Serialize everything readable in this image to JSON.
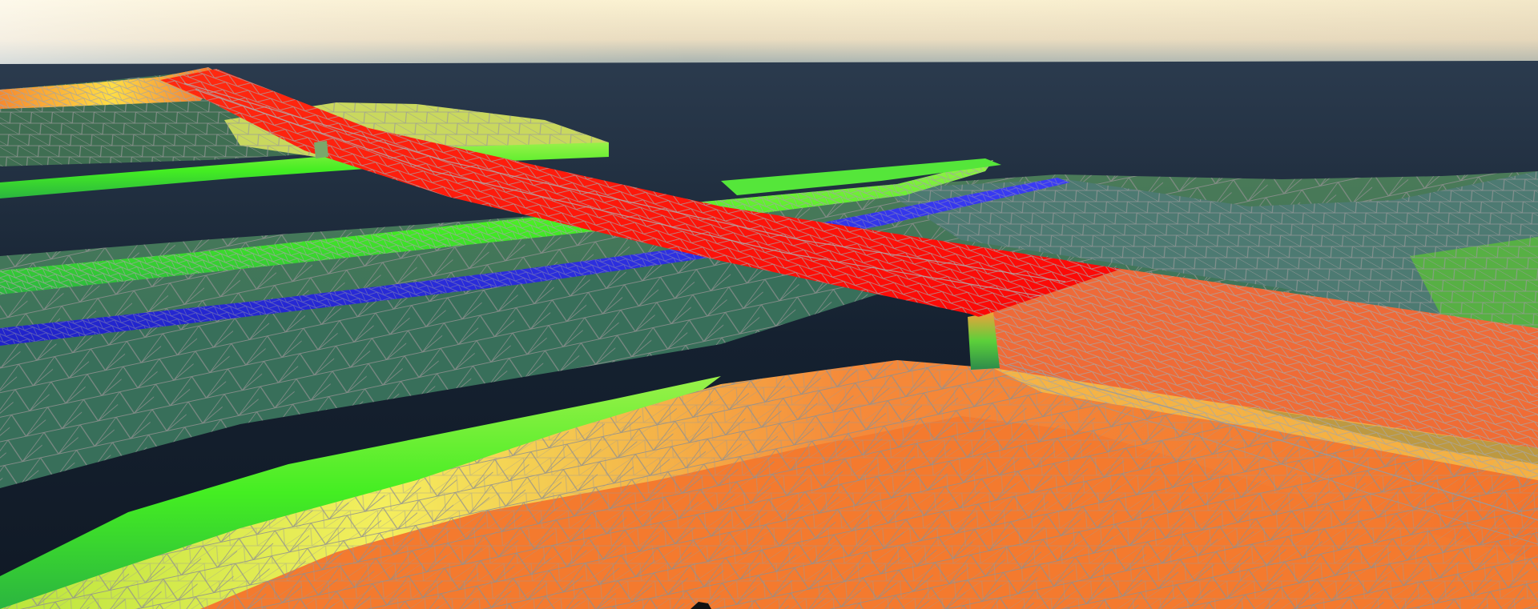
{
  "viewport": {
    "kind": "3d-terrain-mesh-viewer",
    "render_mode": "wireframe-over-shaded-surface"
  },
  "colors": {
    "sky_top": "#7d9aa8",
    "sky_glow": "#fbf2d2",
    "water_deep": "#111b27",
    "water_shallow": "#27384a",
    "low_ground": "#3b6e5a",
    "channel_blue": "#2828f0",
    "levee_green": "#44ee22",
    "slope_yellow": "#f4ec5a",
    "high_orange": "#f57a30",
    "bridge_red": "#fd0d0d",
    "wireframe": "#9a9a9a"
  },
  "legend_visible": false
}
